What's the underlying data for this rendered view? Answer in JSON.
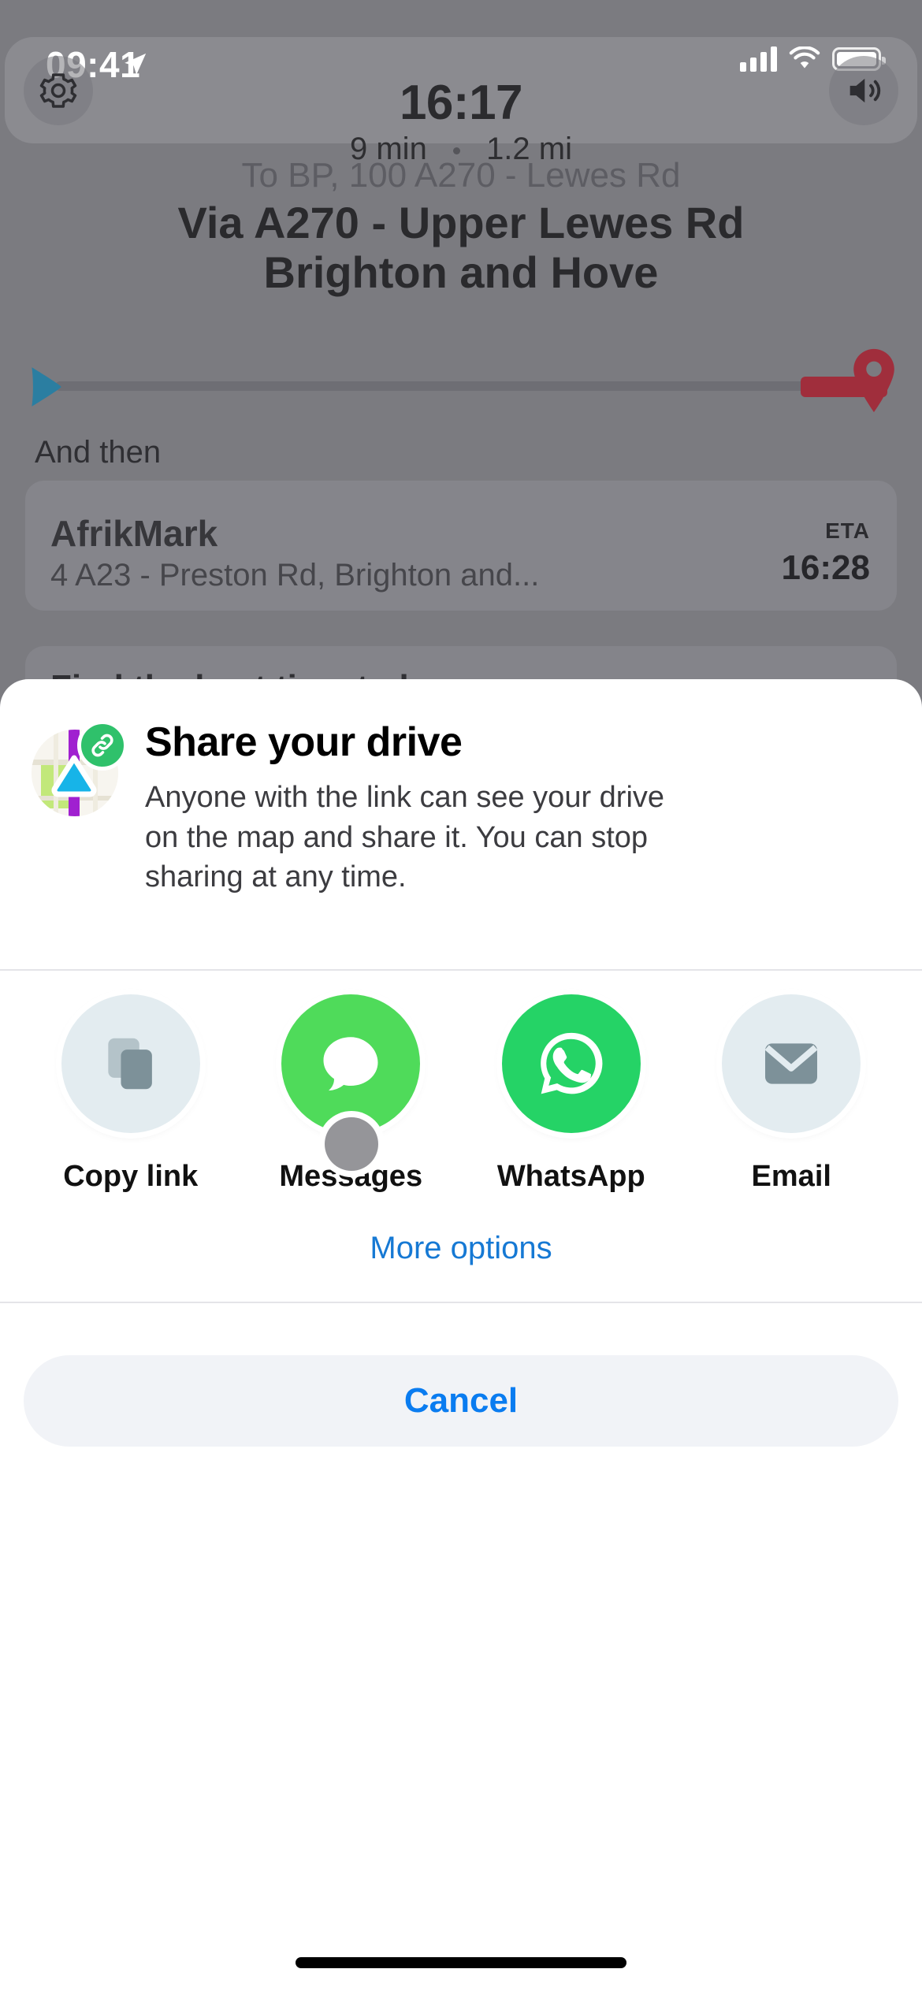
{
  "status_bar": {
    "time": "09:41",
    "location_icon": "location-arrow-icon",
    "signal_icon": "cellular-signal-icon",
    "wifi_icon": "wifi-icon",
    "battery_icon": "battery-full-icon"
  },
  "nav_panel": {
    "arrival_time": "16:17",
    "duration": "9 min",
    "distance": "1.2 mi",
    "settings_icon": "gear-icon",
    "sound_icon": "speaker-icon"
  },
  "route": {
    "destination_line": "To BP, 100 A270 - Lewes Rd",
    "via_line_1": "Via A270 - Upper Lewes Rd",
    "via_line_2": "Brighton and Hove",
    "start_icon": "blue-arrow-icon",
    "end_icon": "destination-pin-icon"
  },
  "and_then": {
    "label": "And then",
    "stop_name": "AfrikMark",
    "stop_address": "4 A23 - Preston Rd, Brighton and...",
    "eta_label": "ETA",
    "eta_time": "16:28"
  },
  "leave_card": {
    "title": "Find the best time to leave"
  },
  "share_sheet": {
    "icon": "map-route-icon",
    "badge_icon": "link-icon",
    "title": "Share your drive",
    "description": "Anyone with the link can see your drive on the map and share it. You can stop sharing at any time.",
    "targets": [
      {
        "label": "Copy link",
        "icon": "copy-icon",
        "color": "#e3ecf0"
      },
      {
        "label": "Messages",
        "icon": "message-bubble-icon",
        "color": "#4fdb5a"
      },
      {
        "label": "WhatsApp",
        "icon": "whatsapp-icon",
        "color": "#25d366"
      },
      {
        "label": "Email",
        "icon": "envelope-icon",
        "color": "#e3ecf0"
      }
    ],
    "more_options_label": "More options",
    "cancel_label": "Cancel"
  },
  "colors": {
    "accent_blue": "#0a7cf0",
    "link_blue": "#1679d4",
    "green": "#25d366",
    "messages_green": "#4fdb5a",
    "pin_red": "#a02e3c",
    "arrow_blue": "#2b7ea1",
    "route_purple": "#a020d0"
  }
}
